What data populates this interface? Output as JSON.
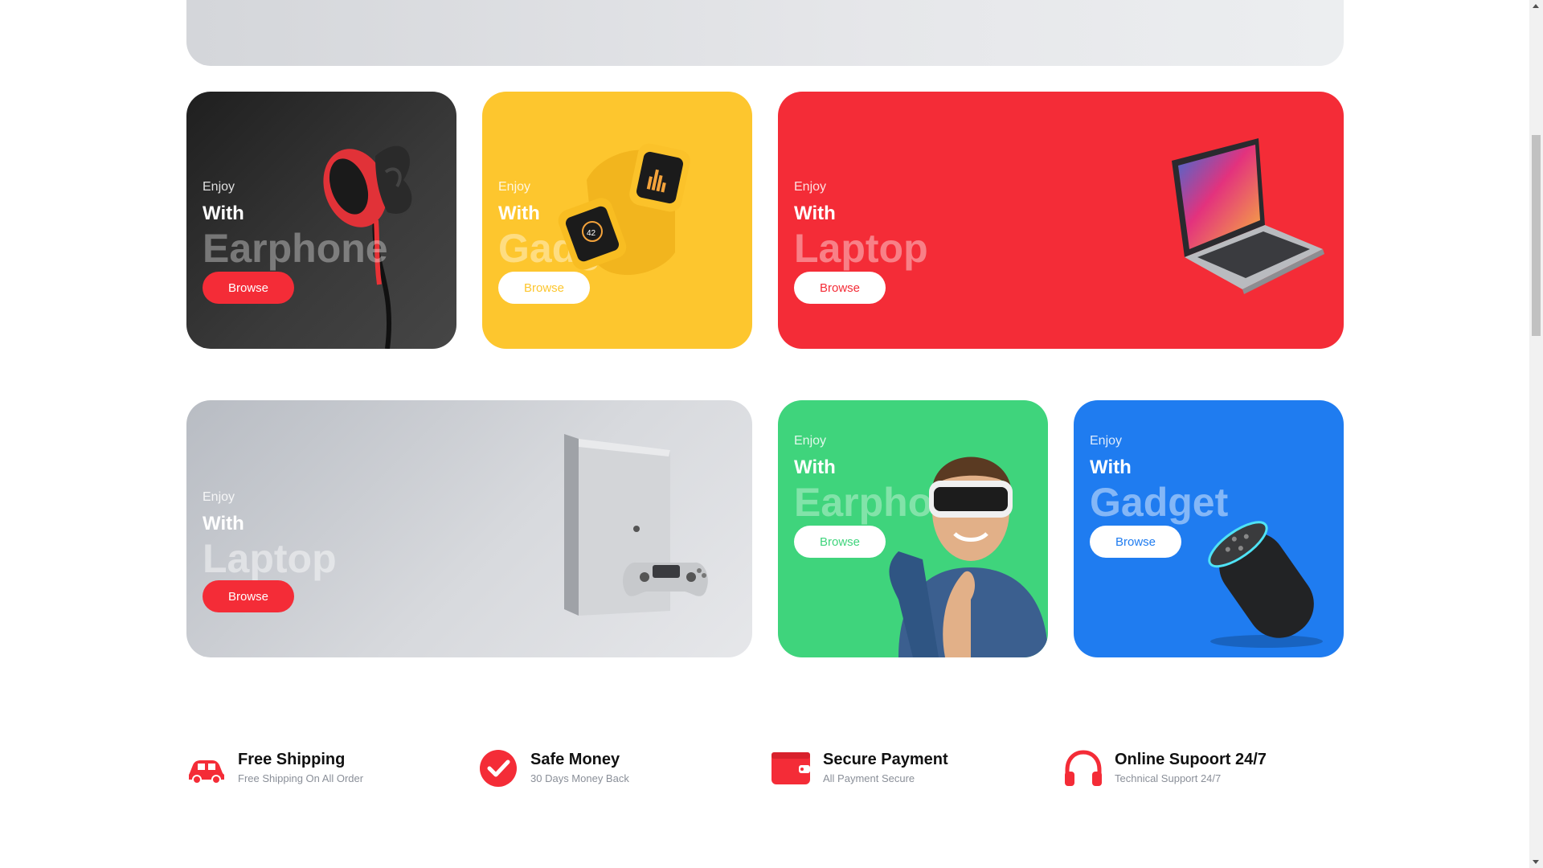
{
  "cards": [
    {
      "enjoy": "Enjoy",
      "with": "With",
      "big": "Earphone",
      "button": "Browse",
      "product_icon": "earphone-icon"
    },
    {
      "enjoy": "Enjoy",
      "with": "With",
      "big": "Gadget",
      "button": "Browse",
      "product_icon": "smartwatch-icon"
    },
    {
      "enjoy": "Enjoy",
      "with": "With",
      "big": "Laptop",
      "button": "Browse",
      "product_icon": "laptop-icon"
    },
    {
      "enjoy": "Enjoy",
      "with": "With",
      "big": "Laptop",
      "button": "Browse",
      "product_icon": "game-console-icon"
    },
    {
      "enjoy": "Enjoy",
      "with": "With",
      "big": "Earphone",
      "button": "Browse",
      "product_icon": "vr-headset-icon"
    },
    {
      "enjoy": "Enjoy",
      "with": "With",
      "big": "Gadget",
      "button": "Browse",
      "product_icon": "smart-speaker-icon"
    }
  ],
  "features": [
    {
      "title": "Free Shipping",
      "subtitle": "Free Shipping On All Order",
      "icon": "car-icon"
    },
    {
      "title": "Safe Money",
      "subtitle": "30 Days Money Back",
      "icon": "check-circle-icon"
    },
    {
      "title": "Secure Payment",
      "subtitle": "All Payment Secure",
      "icon": "wallet-icon"
    },
    {
      "title": "Online Supoort 24/7",
      "subtitle": "Technical Support 24/7",
      "icon": "headphones-icon"
    }
  ],
  "colors": {
    "red": "#f42c37",
    "yellow": "#fdc62e",
    "green": "#3fd47c",
    "blue": "#1f7cf0",
    "dark": "#2b2b2b",
    "grey": "#c9ccd1"
  }
}
